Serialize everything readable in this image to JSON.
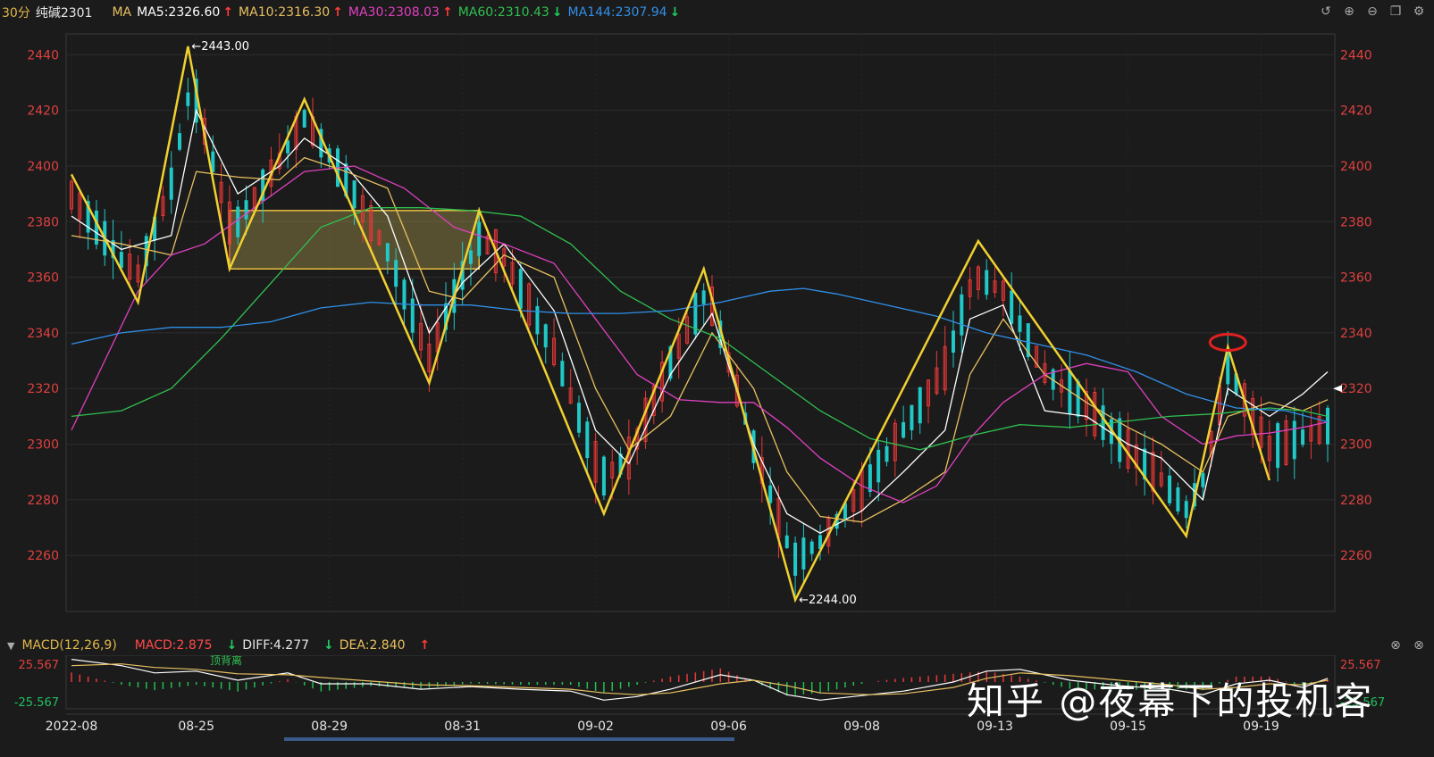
{
  "header": {
    "period": "30分",
    "symbol": "纯碱2301",
    "ma_label": "MA",
    "ma_items": [
      {
        "label": "MA5:2326.60",
        "color": "#ffffff",
        "trend": "up"
      },
      {
        "label": "MA10:2316.30",
        "color": "#e8c060",
        "trend": "up"
      },
      {
        "label": "MA30:2308.03",
        "color": "#e040c0",
        "trend": "up"
      },
      {
        "label": "MA60:2310.43",
        "color": "#30c050",
        "trend": "down"
      },
      {
        "label": "MA144:2307.94",
        "color": "#3090e8",
        "trend": "down"
      }
    ],
    "tools": [
      "undo-icon",
      "zoom-in-icon",
      "zoom-out-icon",
      "restore-icon",
      "settings-icon"
    ]
  },
  "macd_header": {
    "name": "MACD(12,26,9)",
    "macd": "MACD:2.875",
    "diff": "DIFF:4.277",
    "dea": "DEA:2.840",
    "tools": [
      "close-icon",
      "maximize-icon"
    ]
  },
  "watermark": "知乎 @夜幕下的投机客",
  "chart_data": {
    "type": "candlestick",
    "symbol": "纯碱2301",
    "period": "30分",
    "ylim": [
      2244,
      2443
    ],
    "yticks": [
      2260,
      2280,
      2300,
      2320,
      2340,
      2360,
      2380,
      2400,
      2420,
      2440
    ],
    "x_labels": [
      {
        "label": "2022-08",
        "i": 0
      },
      {
        "label": "08-25",
        "i": 15
      },
      {
        "label": "08-29",
        "i": 31
      },
      {
        "label": "08-31",
        "i": 47
      },
      {
        "label": "09-02",
        "i": 63
      },
      {
        "label": "09-06",
        "i": 79
      },
      {
        "label": "09-08",
        "i": 95
      },
      {
        "label": "09-13",
        "i": 111
      },
      {
        "label": "09-15",
        "i": 127
      },
      {
        "label": "09-19",
        "i": 143
      }
    ],
    "annotations": {
      "high": "←2443.00",
      "low": "←2244.00",
      "macd_note": "顶背离",
      "current_price": 2320
    },
    "zigzag": [
      [
        0,
        2397
      ],
      [
        8,
        2351
      ],
      [
        14,
        2443
      ],
      [
        19,
        2363
      ],
      [
        28,
        2424
      ],
      [
        43,
        2322
      ],
      [
        49,
        2384
      ],
      [
        64,
        2275
      ],
      [
        76,
        2363
      ],
      [
        87,
        2244
      ],
      [
        109,
        2373
      ],
      [
        134,
        2267
      ],
      [
        139,
        2335
      ],
      [
        144,
        2287
      ]
    ],
    "box": {
      "x0": 19,
      "x1": 49,
      "y0": 2363,
      "y1": 2384
    },
    "highlight": {
      "i": 139,
      "price": 2335
    },
    "ma_series": {
      "MA5": [
        [
          0,
          2382
        ],
        [
          6,
          2370
        ],
        [
          12,
          2375
        ],
        [
          15,
          2420
        ],
        [
          20,
          2390
        ],
        [
          25,
          2400
        ],
        [
          28,
          2410
        ],
        [
          33,
          2400
        ],
        [
          38,
          2382
        ],
        [
          43,
          2340
        ],
        [
          47,
          2358
        ],
        [
          52,
          2372
        ],
        [
          58,
          2348
        ],
        [
          63,
          2305
        ],
        [
          67,
          2293
        ],
        [
          72,
          2325
        ],
        [
          77,
          2347
        ],
        [
          82,
          2300
        ],
        [
          86,
          2275
        ],
        [
          90,
          2268
        ],
        [
          95,
          2276
        ],
        [
          100,
          2290
        ],
        [
          105,
          2305
        ],
        [
          108,
          2345
        ],
        [
          112,
          2350
        ],
        [
          117,
          2312
        ],
        [
          122,
          2310
        ],
        [
          127,
          2300
        ],
        [
          131,
          2295
        ],
        [
          136,
          2280
        ],
        [
          139,
          2320
        ],
        [
          144,
          2310
        ],
        [
          148,
          2318
        ],
        [
          151,
          2326
        ]
      ],
      "MA10": [
        [
          0,
          2375
        ],
        [
          6,
          2372
        ],
        [
          12,
          2368
        ],
        [
          15,
          2398
        ],
        [
          20,
          2396
        ],
        [
          25,
          2395
        ],
        [
          28,
          2403
        ],
        [
          33,
          2398
        ],
        [
          38,
          2392
        ],
        [
          43,
          2355
        ],
        [
          47,
          2352
        ],
        [
          52,
          2368
        ],
        [
          58,
          2360
        ],
        [
          63,
          2320
        ],
        [
          67,
          2298
        ],
        [
          72,
          2310
        ],
        [
          77,
          2340
        ],
        [
          82,
          2320
        ],
        [
          86,
          2290
        ],
        [
          90,
          2274
        ],
        [
          95,
          2272
        ],
        [
          100,
          2280
        ],
        [
          105,
          2290
        ],
        [
          108,
          2325
        ],
        [
          112,
          2345
        ],
        [
          117,
          2325
        ],
        [
          122,
          2315
        ],
        [
          127,
          2306
        ],
        [
          131,
          2300
        ],
        [
          136,
          2290
        ],
        [
          139,
          2310
        ],
        [
          144,
          2315
        ],
        [
          148,
          2312
        ],
        [
          151,
          2316
        ]
      ],
      "MA30": [
        [
          0,
          2305
        ],
        [
          4,
          2330
        ],
        [
          8,
          2355
        ],
        [
          12,
          2368
        ],
        [
          16,
          2372
        ],
        [
          22,
          2385
        ],
        [
          28,
          2398
        ],
        [
          34,
          2400
        ],
        [
          40,
          2392
        ],
        [
          46,
          2378
        ],
        [
          52,
          2372
        ],
        [
          58,
          2365
        ],
        [
          63,
          2345
        ],
        [
          68,
          2325
        ],
        [
          73,
          2316
        ],
        [
          78,
          2315
        ],
        [
          82,
          2315
        ],
        [
          86,
          2306
        ],
        [
          90,
          2295
        ],
        [
          95,
          2285
        ],
        [
          100,
          2279
        ],
        [
          104,
          2285
        ],
        [
          108,
          2302
        ],
        [
          112,
          2315
        ],
        [
          117,
          2325
        ],
        [
          122,
          2329
        ],
        [
          127,
          2326
        ],
        [
          131,
          2310
        ],
        [
          136,
          2300
        ],
        [
          140,
          2303
        ],
        [
          144,
          2304
        ],
        [
          148,
          2306
        ],
        [
          151,
          2308
        ]
      ],
      "MA60": [
        [
          0,
          2310
        ],
        [
          6,
          2312
        ],
        [
          12,
          2320
        ],
        [
          18,
          2338
        ],
        [
          24,
          2358
        ],
        [
          30,
          2378
        ],
        [
          36,
          2385
        ],
        [
          42,
          2385
        ],
        [
          48,
          2384
        ],
        [
          54,
          2382
        ],
        [
          60,
          2372
        ],
        [
          66,
          2355
        ],
        [
          72,
          2345
        ],
        [
          78,
          2338
        ],
        [
          84,
          2325
        ],
        [
          90,
          2312
        ],
        [
          96,
          2302
        ],
        [
          102,
          2298
        ],
        [
          108,
          2303
        ],
        [
          114,
          2307
        ],
        [
          120,
          2306
        ],
        [
          126,
          2308
        ],
        [
          132,
          2310
        ],
        [
          138,
          2311
        ],
        [
          144,
          2313
        ],
        [
          148,
          2312
        ],
        [
          151,
          2310
        ]
      ],
      "MA144": [
        [
          0,
          2336
        ],
        [
          6,
          2340
        ],
        [
          12,
          2342
        ],
        [
          18,
          2342
        ],
        [
          24,
          2344
        ],
        [
          30,
          2349
        ],
        [
          36,
          2351
        ],
        [
          42,
          2350
        ],
        [
          48,
          2350
        ],
        [
          54,
          2348
        ],
        [
          60,
          2347
        ],
        [
          66,
          2347
        ],
        [
          72,
          2348
        ],
        [
          78,
          2351
        ],
        [
          84,
          2355
        ],
        [
          88,
          2356
        ],
        [
          92,
          2354
        ],
        [
          98,
          2350
        ],
        [
          104,
          2346
        ],
        [
          110,
          2340
        ],
        [
          116,
          2336
        ],
        [
          122,
          2332
        ],
        [
          128,
          2326
        ],
        [
          134,
          2318
        ],
        [
          140,
          2313
        ],
        [
          146,
          2312
        ],
        [
          151,
          2308
        ]
      ]
    },
    "macd": {
      "ylim": [
        -25.567,
        25.567
      ],
      "yticks": [
        25.567,
        -25.567
      ],
      "diff": [
        [
          0,
          25
        ],
        [
          6,
          18
        ],
        [
          10,
          10
        ],
        [
          15,
          12
        ],
        [
          20,
          2
        ],
        [
          26,
          10
        ],
        [
          30,
          -2
        ],
        [
          36,
          -2
        ],
        [
          42,
          -8
        ],
        [
          48,
          -5
        ],
        [
          54,
          -8
        ],
        [
          60,
          -10
        ],
        [
          64,
          -20
        ],
        [
          68,
          -16
        ],
        [
          72,
          -8
        ],
        [
          78,
          8
        ],
        [
          82,
          2
        ],
        [
          86,
          -14
        ],
        [
          90,
          -20
        ],
        [
          96,
          -14
        ],
        [
          100,
          -10
        ],
        [
          106,
          0
        ],
        [
          110,
          12
        ],
        [
          114,
          14
        ],
        [
          120,
          2
        ],
        [
          126,
          -4
        ],
        [
          132,
          -8
        ],
        [
          136,
          -14
        ],
        [
          140,
          -2
        ],
        [
          144,
          2
        ],
        [
          148,
          -6
        ],
        [
          151,
          4
        ]
      ],
      "dea": [
        [
          0,
          18
        ],
        [
          6,
          20
        ],
        [
          10,
          16
        ],
        [
          15,
          14
        ],
        [
          20,
          9
        ],
        [
          26,
          8
        ],
        [
          30,
          5
        ],
        [
          36,
          1
        ],
        [
          42,
          -3
        ],
        [
          48,
          -4
        ],
        [
          54,
          -6
        ],
        [
          60,
          -8
        ],
        [
          64,
          -12
        ],
        [
          68,
          -14
        ],
        [
          72,
          -12
        ],
        [
          78,
          -2
        ],
        [
          82,
          2
        ],
        [
          86,
          -4
        ],
        [
          90,
          -12
        ],
        [
          96,
          -14
        ],
        [
          100,
          -13
        ],
        [
          106,
          -6
        ],
        [
          110,
          4
        ],
        [
          114,
          10
        ],
        [
          120,
          7
        ],
        [
          126,
          2
        ],
        [
          132,
          -3
        ],
        [
          136,
          -8
        ],
        [
          140,
          -6
        ],
        [
          144,
          -2
        ],
        [
          148,
          -3
        ],
        [
          151,
          2
        ]
      ]
    }
  }
}
